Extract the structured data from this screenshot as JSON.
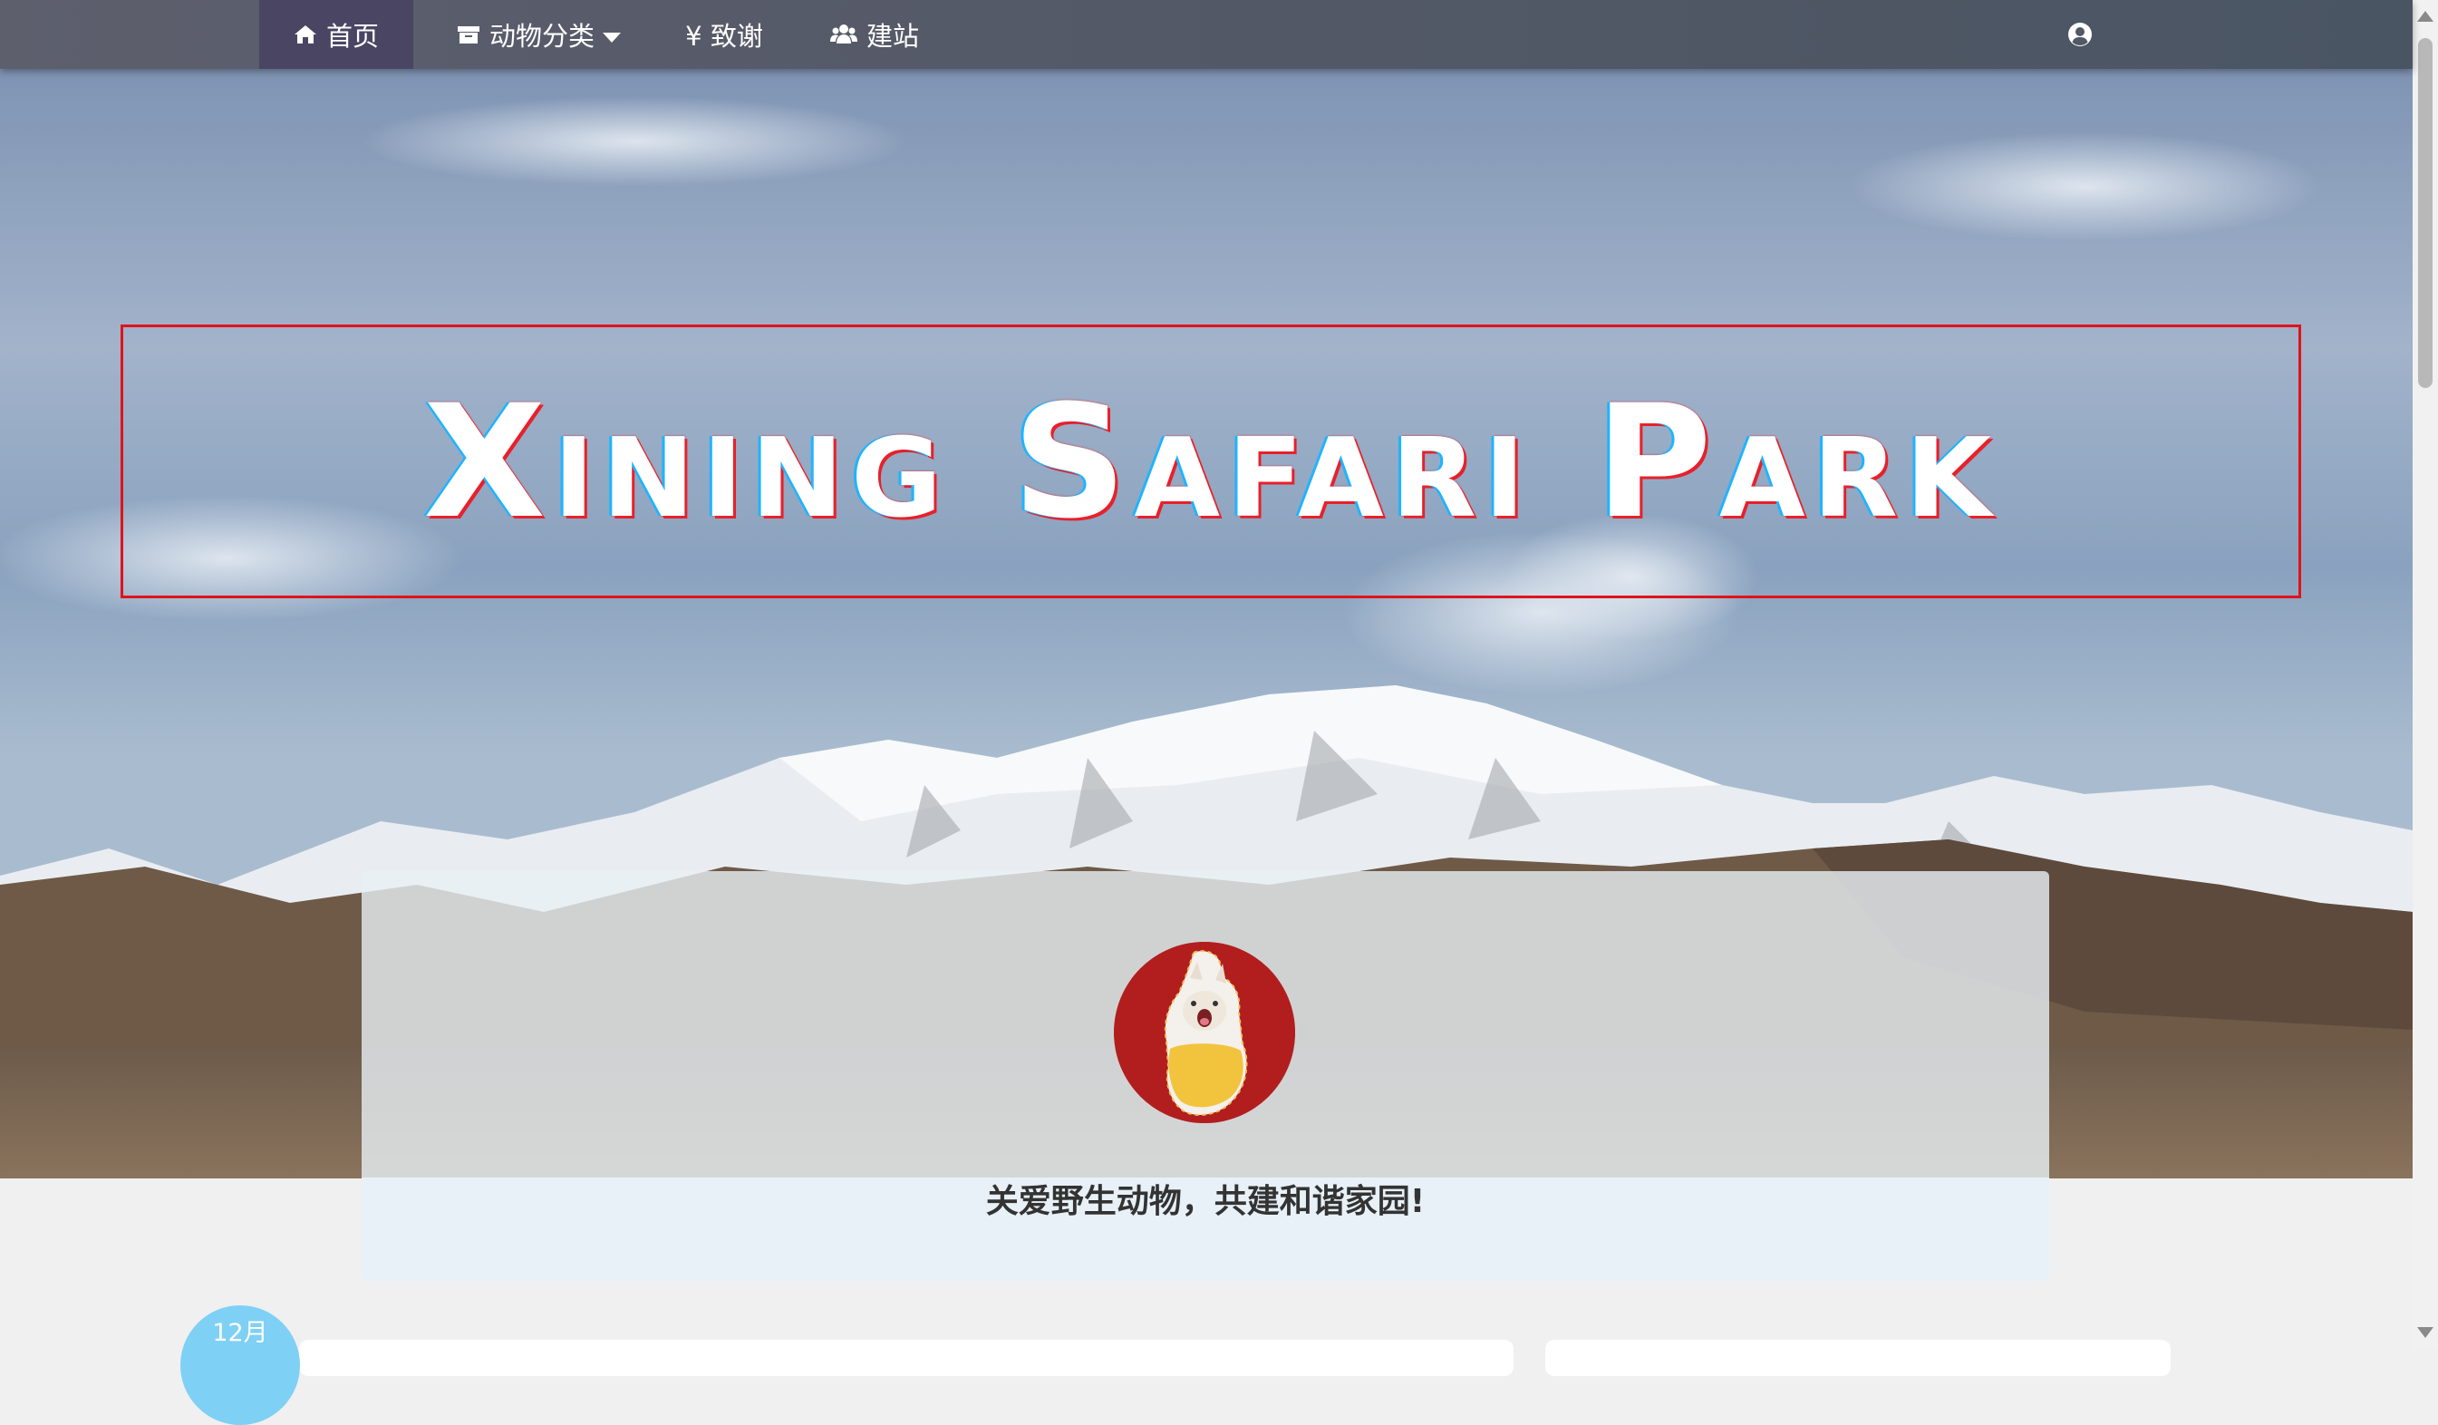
{
  "nav": {
    "home": "首页",
    "animals": "动物分类",
    "thanks": "¥ 致谢",
    "build": "建站",
    "home_icon": "home-icon",
    "animals_icon": "archive-icon",
    "build_icon": "users-icon",
    "user_icon": "user-circle-icon"
  },
  "hero": {
    "title": "Xining Safari Park"
  },
  "card": {
    "slogan": "关爱野生动物，共建和谐家园!"
  },
  "post": {
    "date": "12月"
  },
  "colors": {
    "accent": "#e0131b",
    "nav_bg": "#525866",
    "badge": "#7fd0f5",
    "avatar_bg": "#b21e1e"
  }
}
